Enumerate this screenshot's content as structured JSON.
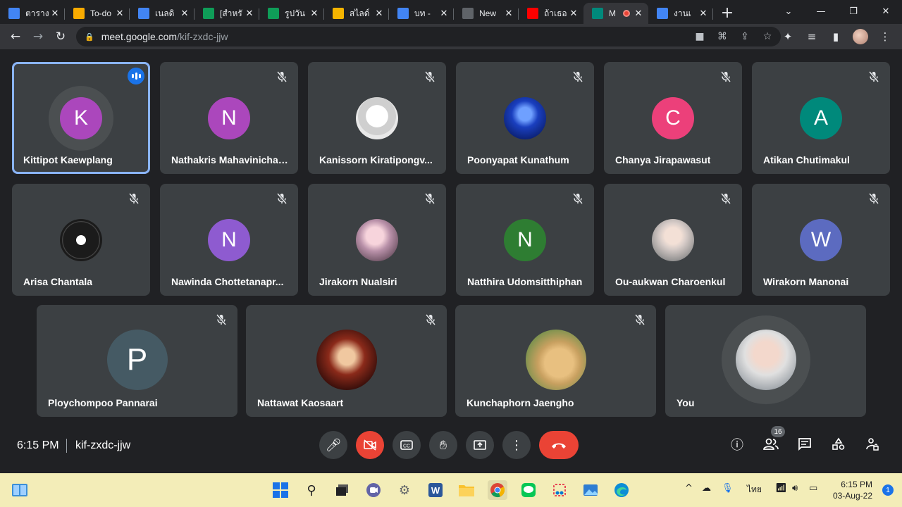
{
  "browser": {
    "tabs": [
      {
        "title": "ตาราง",
        "icon": "docs-icon",
        "color": "#4285f4"
      },
      {
        "title": "To-do",
        "icon": "classroom-icon",
        "color": "#f9ab00"
      },
      {
        "title": "เนลดิ",
        "icon": "docs-icon",
        "color": "#4285f4"
      },
      {
        "title": "[สำหรั",
        "icon": "drive-icon",
        "color": "#0f9d58"
      },
      {
        "title": "รูปวัน",
        "icon": "drive-icon",
        "color": "#0f9d58"
      },
      {
        "title": "สไลด์",
        "icon": "slides-icon",
        "color": "#f4b400"
      },
      {
        "title": "บท - ",
        "icon": "docs-icon",
        "color": "#4285f4"
      },
      {
        "title": "New",
        "icon": "chrome-icon",
        "color": "#5f6368"
      },
      {
        "title": "ถ้าเธอ",
        "icon": "youtube-icon",
        "color": "#ff0000"
      },
      {
        "title": "M",
        "icon": "meet-icon",
        "color": "#00897b"
      },
      {
        "title": "งานเ",
        "icon": "docs-icon",
        "color": "#4285f4"
      }
    ],
    "url_host": "meet.google.com",
    "url_path": "/kif-zxdc-jjw"
  },
  "participants": [
    {
      "name": "Kittipot Kaewplang",
      "initial": "K",
      "color": "#ab47bc"
    },
    {
      "name": "Nathakris Mahavinichai...",
      "initial": "N",
      "color": "#ab47bc"
    },
    {
      "name": "Kanissorn Kiratipongv...",
      "initial": "",
      "color": "#e0e0e0"
    },
    {
      "name": "Poonyapat Kunathum",
      "initial": "",
      "color": "#1a3fbf"
    },
    {
      "name": "Chanya Jirapawasut",
      "initial": "C",
      "color": "#ec407a"
    },
    {
      "name": "Atikan Chutimakul",
      "initial": "A",
      "color": "#00897b"
    },
    {
      "name": "Arisa Chantala",
      "initial": "",
      "color": "#1b1b1b"
    },
    {
      "name": "Nawinda Chottetanapr...",
      "initial": "N",
      "color": "#8e5bd0"
    },
    {
      "name": "Jirakorn Nualsiri",
      "initial": "",
      "color": "#c9a8a0"
    },
    {
      "name": "Natthira Udomsitthiphan",
      "initial": "N",
      "color": "#2e7d32"
    },
    {
      "name": "Ou-aukwan Charoenkul",
      "initial": "",
      "color": "#d7ccc8"
    },
    {
      "name": "Wirakorn Manonai",
      "initial": "W",
      "color": "#5c6bc0"
    },
    {
      "name": "Ploychompoo Pannarai",
      "initial": "P",
      "color": "#455a64"
    },
    {
      "name": "Nattawat Kaosaart",
      "initial": "",
      "color": "#5d1a12"
    },
    {
      "name": "Kunchaphorn Jaengho",
      "initial": "",
      "color": "#c8a060"
    },
    {
      "name": "You",
      "initial": "",
      "color": "#d9c8c0"
    }
  ],
  "meeting": {
    "time": "6:15 PM",
    "code": "kif-zxdc-jjw",
    "participant_count": "16"
  },
  "taskbar": {
    "lang": "ไทย",
    "time": "6:15 PM",
    "date": "03-Aug-22",
    "notifications": "1"
  }
}
